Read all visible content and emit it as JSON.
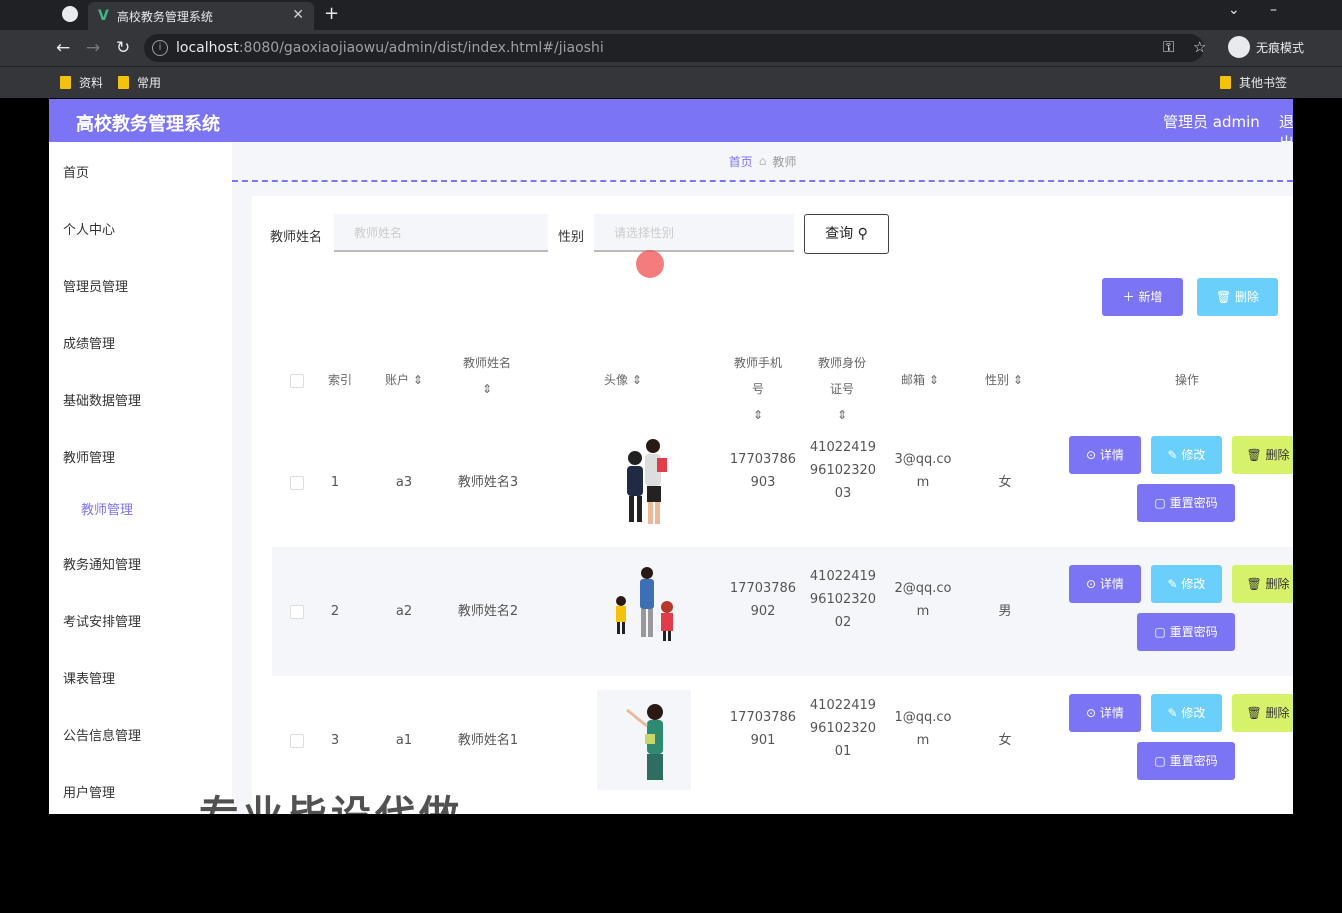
{
  "browser": {
    "tab_title": "高校教务管理系统",
    "url_host": "localhost",
    "url_rest": ":8080/gaoxiaojiaowu/admin/dist/index.html#/jiaoshi",
    "profile_label": "无痕模式",
    "bookmarks": [
      "资料",
      "常用"
    ],
    "other_bookmarks": "其他书签"
  },
  "header": {
    "title": "高校教务管理系统",
    "user": "管理员 admin",
    "logout": "退出登录"
  },
  "sidebar": {
    "items": [
      {
        "label": "首页"
      },
      {
        "label": "个人中心"
      },
      {
        "label": "管理员管理"
      },
      {
        "label": "成绩管理"
      },
      {
        "label": "基础数据管理"
      },
      {
        "label": "教师管理"
      },
      {
        "label": "教师管理"
      },
      {
        "label": "教务通知管理"
      },
      {
        "label": "考试安排管理"
      },
      {
        "label": "课表管理"
      },
      {
        "label": "公告信息管理"
      },
      {
        "label": "用户管理"
      }
    ]
  },
  "breadcrumb": {
    "home": "首页",
    "current": "教师"
  },
  "search": {
    "name_label": "教师姓名",
    "name_placeholder": "教师姓名",
    "gender_label": "性别",
    "gender_placeholder": "请选择性别",
    "query_button": "查询"
  },
  "actions": {
    "add": "新增",
    "delete": "删除"
  },
  "table": {
    "headers": {
      "index": "索引",
      "account": "账户",
      "name": "教师姓名",
      "avatar": "头像",
      "phone": "教师手机号",
      "idcard": "教师身份证号",
      "email": "邮箱",
      "gender": "性别",
      "ops": "操作"
    },
    "rows": [
      {
        "index": "1",
        "account": "a3",
        "name": "教师姓名3",
        "phone1": "17703786",
        "phone2": "903",
        "id1": "41022419",
        "id2": "96102320",
        "id3": "03",
        "email1": "3@qq.co",
        "email2": "m",
        "gender": "女"
      },
      {
        "index": "2",
        "account": "a2",
        "name": "教师姓名2",
        "phone1": "17703786",
        "phone2": "902",
        "id1": "41022419",
        "id2": "96102320",
        "id3": "02",
        "email1": "2@qq.co",
        "email2": "m",
        "gender": "男"
      },
      {
        "index": "3",
        "account": "a1",
        "name": "教师姓名1",
        "phone1": "17703786",
        "phone2": "901",
        "id1": "41022419",
        "id2": "96102320",
        "id3": "01",
        "email1": "1@qq.co",
        "email2": "m",
        "gender": "女"
      }
    ],
    "row_buttons": {
      "detail": "详情",
      "edit": "修改",
      "delete": "删除",
      "reset": "重置密码"
    }
  },
  "watermark": "专业毕设代做",
  "colors": {
    "primary": "#7b74f5",
    "info": "#6bcffb",
    "warn": "#d6f26a"
  }
}
